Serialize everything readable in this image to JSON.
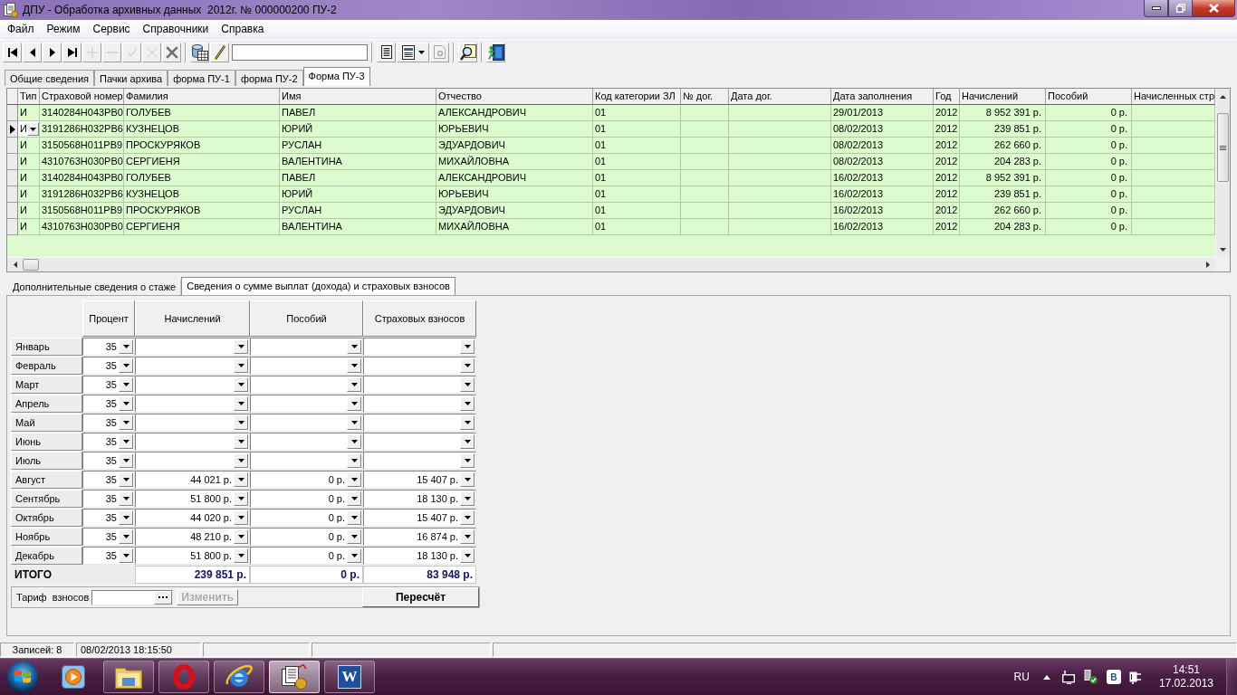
{
  "window": {
    "title": "ДПУ - Обработка архивных данных  2012г. № 000000200 ПУ-2"
  },
  "menu": [
    "Файл",
    "Режим",
    "Сервис",
    "Справочники",
    "Справка"
  ],
  "toolbar": {
    "groups": [
      [
        {
          "kind": "first",
          "disabled": false
        },
        {
          "kind": "prior",
          "disabled": false
        },
        {
          "kind": "next",
          "disabled": false
        },
        {
          "kind": "last",
          "disabled": false
        },
        {
          "kind": "insert",
          "disabled": true
        },
        {
          "kind": "delete",
          "disabled": true
        },
        {
          "kind": "post",
          "disabled": true
        },
        {
          "kind": "cancel",
          "disabled": true
        },
        {
          "kind": "remove",
          "disabled": false
        }
      ],
      [
        {
          "kind": "database",
          "disabled": false
        },
        {
          "kind": "pen",
          "disabled": false
        },
        {
          "kind": "input"
        }
      ],
      [
        {
          "kind": "document",
          "disabled": false
        },
        {
          "kind": "report",
          "disabled": false
        },
        {
          "kind": "page",
          "disabled": true
        }
      ],
      [
        {
          "kind": "finder",
          "disabled": false
        }
      ],
      [
        {
          "kind": "exit",
          "disabled": false
        }
      ]
    ]
  },
  "tabs": [
    {
      "label": "Общие сведения",
      "selected": false
    },
    {
      "label": "Пачки архива",
      "selected": false
    },
    {
      "label": "форма ПУ-1",
      "selected": false
    },
    {
      "label": "форма ПУ-2",
      "selected": false
    },
    {
      "label": "Форма ПУ-3",
      "selected": true
    }
  ],
  "table": {
    "columns": [
      "Тип",
      "Страховой номер",
      "Фамилия",
      "Имя",
      "Отчество",
      "Код категории ЗЛ",
      "№ дог.",
      "Дата дог.",
      "Дата заполнения",
      "Год",
      "Начислений",
      "Пособий",
      "Начисленных стр"
    ],
    "rows": [
      {
        "selected": false,
        "type": "И",
        "insurance_number": "3140284H043PB0",
        "surname": "ГОЛУБЕВ",
        "name": "ПАВЕЛ",
        "patronymic": "АЛЕКСАНДРОВИЧ",
        "category_code": "01",
        "fill_date": "29/01/2013",
        "year": "2012",
        "accrued": "8 952 391 р.",
        "benefits": "0 р."
      },
      {
        "selected": true,
        "type": "И",
        "insurance_number": "3191286H032PB6",
        "surname": "КУЗНЕЦОВ",
        "name": "ЮРИЙ",
        "patronymic": "ЮРЬЕВИЧ",
        "category_code": "01",
        "fill_date": "08/02/2013",
        "year": "2012",
        "accrued": "239 851 р.",
        "benefits": "0 р."
      },
      {
        "selected": false,
        "type": "И",
        "insurance_number": "3150568H011PB9",
        "surname": "ПРОСКУРЯКОВ",
        "name": "РУСЛАН",
        "patronymic": "ЭДУАРДОВИЧ",
        "category_code": "01",
        "fill_date": "08/02/2013",
        "year": "2012",
        "accrued": "262 660 р.",
        "benefits": "0 р."
      },
      {
        "selected": false,
        "type": "И",
        "insurance_number": "4310763H030PB0",
        "surname": "СЕРГИЕНЯ",
        "name": "ВАЛЕНТИНА",
        "patronymic": "МИХАЙЛОВНА",
        "category_code": "01",
        "fill_date": "08/02/2013",
        "year": "2012",
        "accrued": "204 283 р.",
        "benefits": "0 р."
      },
      {
        "selected": false,
        "type": "И",
        "insurance_number": "3140284H043PB0",
        "surname": "ГОЛУБЕВ",
        "name": "ПАВЕЛ",
        "patronymic": "АЛЕКСАНДРОВИЧ",
        "category_code": "01",
        "fill_date": "16/02/2013",
        "year": "2012",
        "accrued": "8 952 391 р.",
        "benefits": "0 р."
      },
      {
        "selected": false,
        "type": "И",
        "insurance_number": "3191286H032PB6",
        "surname": "КУЗНЕЦОВ",
        "name": "ЮРИЙ",
        "patronymic": "ЮРЬЕВИЧ",
        "category_code": "01",
        "fill_date": "16/02/2013",
        "year": "2012",
        "accrued": "239 851 р.",
        "benefits": "0 р."
      },
      {
        "selected": false,
        "type": "И",
        "insurance_number": "3150568H011PB9",
        "surname": "ПРОСКУРЯКОВ",
        "name": "РУСЛАН",
        "patronymic": "ЭДУАРДОВИЧ",
        "category_code": "01",
        "fill_date": "16/02/2013",
        "year": "2012",
        "accrued": "262 660 р.",
        "benefits": "0 р."
      },
      {
        "selected": false,
        "type": "И",
        "insurance_number": "4310763H030PB0",
        "surname": "СЕРГИЕНЯ",
        "name": "ВАЛЕНТИНА",
        "patronymic": "МИХАЙЛОВНА",
        "category_code": "01",
        "fill_date": "16/02/2013",
        "year": "2012",
        "accrued": "204 283 р.",
        "benefits": "0 р."
      }
    ]
  },
  "detail_tabs": [
    {
      "label": "Дополнительные сведения о стаже",
      "selected": false
    },
    {
      "label": "Сведения о сумме выплат (дохода) и страховых взносов",
      "selected": true
    }
  ],
  "monthly": {
    "columns": [
      "Процент",
      "Начислений",
      "Пособий",
      "Страховых взносов"
    ],
    "rows": [
      {
        "month": "Январь",
        "percent": "35"
      },
      {
        "month": "Февраль",
        "percent": "35"
      },
      {
        "month": "Март",
        "percent": "35"
      },
      {
        "month": "Апрель",
        "percent": "35"
      },
      {
        "month": "Май",
        "percent": "35"
      },
      {
        "month": "Июнь",
        "percent": "35"
      },
      {
        "month": "Июль",
        "percent": "35"
      },
      {
        "month": "Август",
        "percent": "35",
        "accrued": "44 021 р.",
        "benefits": "0 р.",
        "contributions": "15 407 р."
      },
      {
        "month": "Сентябрь",
        "percent": "35",
        "accrued": "51 800 р.",
        "benefits": "0 р.",
        "contributions": "18 130 р."
      },
      {
        "month": "Октябрь",
        "percent": "35",
        "accrued": "44 020 р.",
        "benefits": "0 р.",
        "contributions": "15 407 р."
      },
      {
        "month": "Ноябрь",
        "percent": "35",
        "accrued": "48 210 р.",
        "benefits": "0 р.",
        "contributions": "16 874 р."
      },
      {
        "month": "Декабрь",
        "percent": "35",
        "accrued": "51 800 р.",
        "benefits": "0 р.",
        "contributions": "18 130 р."
      }
    ],
    "total": {
      "label": "ИТОГО",
      "accrued": "239 851 р.",
      "benefits": "0 р.",
      "contributions": "83 948 р."
    }
  },
  "tariff": {
    "label": "Тариф  взносов",
    "change_button": {
      "label": "Изменить",
      "disabled": true
    }
  },
  "recalc_button": {
    "label": "Пересчёт",
    "disabled": false
  },
  "status_bar": [
    "Записей: 8",
    "08/02/2013 18:15:50"
  ],
  "taskbar": {
    "apps": [
      {
        "kind": "player",
        "running": false,
        "active": false
      },
      {
        "kind": "folder",
        "running": true,
        "active": false
      },
      {
        "kind": "ring",
        "running": true,
        "active": false
      },
      {
        "kind": "globe",
        "running": true,
        "active": false
      },
      {
        "kind": "documents",
        "running": true,
        "active": true
      },
      {
        "kind": "letter",
        "label": "W",
        "running": true,
        "active": false
      }
    ],
    "tray": {
      "language": "RU",
      "badge": "В",
      "time": "14:51",
      "date": "17.02.2013"
    }
  }
}
